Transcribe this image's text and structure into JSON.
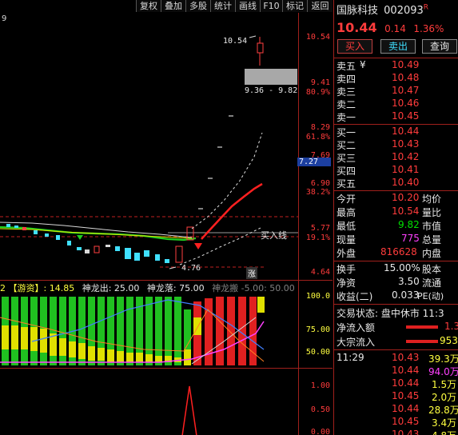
{
  "toolbar": [
    "复权",
    "叠加",
    "多股",
    "统计",
    "画线",
    "F10",
    "标记",
    "返回"
  ],
  "main": {
    "corner_label": "9",
    "high_label": "10.54",
    "low_label": "4.76",
    "range_label": "9.36 - 9.82",
    "buy_signal": "买入线",
    "zhang_tag": "涨",
    "price_axis": [
      "10.54",
      "9.41",
      "80.9%",
      "8.29",
      "61.8%",
      "7.69",
      "7.27",
      "6.90",
      "38.2%",
      "5.77",
      "19.1%",
      "4.64"
    ]
  },
  "indicator": {
    "title": "2 【游资】: 14.85",
    "shenlong_out": "神龙出: 25.00",
    "shenlong_fall": "神龙落: 75.00",
    "shenlong_dead": "神龙搬 -5.00",
    "extra": ": 50.00",
    "axis": [
      "100.0",
      "75.00",
      "50.00"
    ]
  },
  "sub2": {
    "axis": [
      "1.00",
      "0.50",
      "0.00"
    ]
  },
  "panel": {
    "name": "国脉科技",
    "code": "002093",
    "badge": "R",
    "price": "10.44",
    "change": "0.14",
    "pct": "1.36%",
    "buy_btn": "买入",
    "sell_btn": "卖出",
    "query_btn": "查询",
    "asks": [
      {
        "label": "卖五",
        "price": "10.49"
      },
      {
        "label": "卖四",
        "price": "10.48"
      },
      {
        "label": "卖三",
        "price": "10.47"
      },
      {
        "label": "卖二",
        "price": "10.46"
      },
      {
        "label": "卖一",
        "price": "10.45"
      }
    ],
    "ask_currency": "¥",
    "bids": [
      {
        "label": "买一",
        "price": "10.44"
      },
      {
        "label": "买二",
        "price": "10.43"
      },
      {
        "label": "买三",
        "price": "10.42"
      },
      {
        "label": "买四",
        "price": "10.41"
      },
      {
        "label": "买五",
        "price": "10.40"
      }
    ],
    "stats1": [
      {
        "k": "今开",
        "v": "10.20",
        "k2": "均价"
      },
      {
        "k": "最高",
        "v": "10.54",
        "k2": "量比"
      },
      {
        "k": "最低",
        "v": "9.82",
        "k2": "市值"
      },
      {
        "k": "现量",
        "v": "775",
        "k2": "总量"
      },
      {
        "k": "外盘",
        "v": "816628",
        "k2": "内盘"
      }
    ],
    "stats2": [
      {
        "k": "换手",
        "v": "15.00%",
        "k2": "股本"
      },
      {
        "k": "净资",
        "v": "3.50",
        "k2": "流通"
      },
      {
        "k": "收益(二)",
        "v": "0.033",
        "k2": "PE(动)"
      }
    ],
    "trade_status": "交易状态: 盘中休市 11:3",
    "net_inflow_label": "净流入额",
    "net_inflow_value": "1.3",
    "block_inflow_label": "大宗流入",
    "block_inflow_value": "953",
    "ticks": [
      {
        "time": "11:29",
        "price": "10.43",
        "vol": "39.3万"
      },
      {
        "time": "",
        "price": "10.44",
        "vol": "94.0万"
      },
      {
        "time": "",
        "price": "10.44",
        "vol": "1.5万"
      },
      {
        "time": "",
        "price": "10.45",
        "vol": "2.0万"
      },
      {
        "time": "",
        "price": "10.44",
        "vol": "28.8万"
      },
      {
        "time": "",
        "price": "10.45",
        "vol": "3.4万"
      },
      {
        "time": "",
        "price": "10.43",
        "vol": "4.8万"
      }
    ]
  }
}
